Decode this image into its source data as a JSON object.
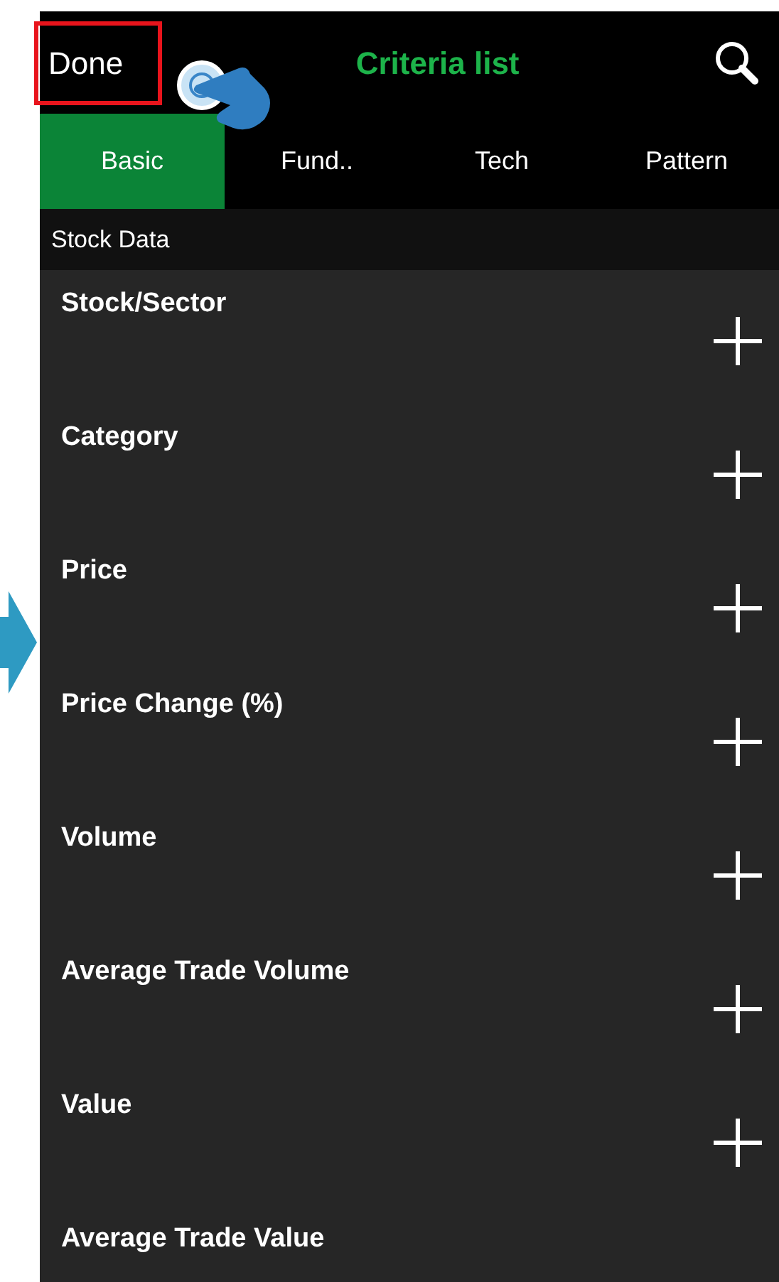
{
  "header": {
    "done": {
      "label": "Done",
      "highlighted": true
    },
    "title": "Criteria list"
  },
  "tabs": [
    {
      "label": "Basic",
      "selected": true
    },
    {
      "label": "Fund..",
      "selected": false
    },
    {
      "label": "Tech",
      "selected": false
    },
    {
      "label": "Pattern",
      "selected": false
    }
  ],
  "section": "Stock Data",
  "criteria": [
    {
      "name": "Stock/Sector"
    },
    {
      "name": "Category"
    },
    {
      "name": "Price"
    },
    {
      "name": "Price Change (%)"
    },
    {
      "name": "Volume"
    },
    {
      "name": "Average Trade Volume"
    },
    {
      "name": "Value"
    },
    {
      "name": "Average Trade Value"
    }
  ]
}
